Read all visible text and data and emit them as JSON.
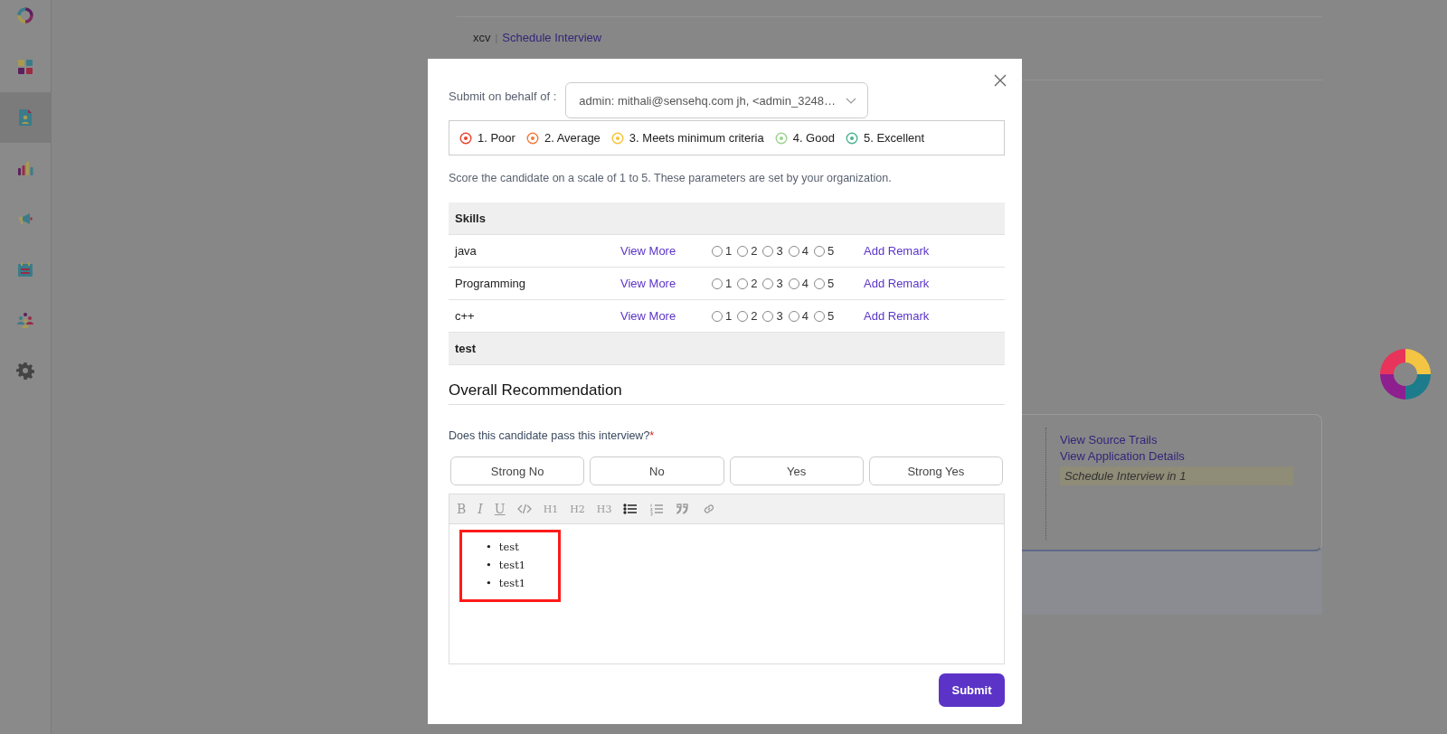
{
  "sidebar": {
    "items": [
      {
        "kind": "logo",
        "selected": false
      },
      {
        "kind": "dashboard",
        "selected": false
      },
      {
        "kind": "candidates",
        "selected": true
      },
      {
        "kind": "reports",
        "selected": false
      },
      {
        "kind": "campaigns",
        "selected": false
      },
      {
        "kind": "calendar",
        "selected": false
      },
      {
        "kind": "team",
        "selected": false
      },
      {
        "kind": "settings",
        "selected": false
      }
    ]
  },
  "page": {
    "breadcrumb": {
      "item": "xcv",
      "separator": "|",
      "link": "Schedule Interview"
    },
    "links": [
      "View Source Trails",
      "View Application Details"
    ],
    "note": "Schedule Interview in 1"
  },
  "modal": {
    "behalf_label": "Submit on behalf of :",
    "behalf_value": "admin: mithali@sensehq.com jh, <admin_3248…",
    "scale": [
      {
        "label": "1. Poor",
        "color": "#e8412c"
      },
      {
        "label": "2. Average",
        "color": "#f47a3a"
      },
      {
        "label": "3. Meets minimum criteria",
        "color": "#f6c431"
      },
      {
        "label": "4. Good",
        "color": "#9bd38f"
      },
      {
        "label": "5. Excellent",
        "color": "#4cb48e"
      }
    ],
    "description": "Score the candidate on a scale of 1 to 5. These parameters are set by your organization.",
    "sections": [
      {
        "title": "Skills",
        "rows": [
          {
            "name": "java",
            "link": "View More",
            "options": [
              {
                "label": "1",
                "selected": false
              },
              {
                "label": "2",
                "selected": false
              },
              {
                "label": "3",
                "selected": false
              },
              {
                "label": "4",
                "selected": false
              },
              {
                "label": "5",
                "selected": false
              }
            ],
            "remark": "Add Remark"
          },
          {
            "name": "Programming",
            "link": "View More",
            "options": [
              {
                "label": "1",
                "selected": false
              },
              {
                "label": "2",
                "selected": false
              },
              {
                "label": "3",
                "selected": false
              },
              {
                "label": "4",
                "selected": false
              },
              {
                "label": "5",
                "selected": false
              }
            ],
            "remark": "Add Remark"
          },
          {
            "name": "c++",
            "link": "View More",
            "options": [
              {
                "label": "1",
                "selected": false
              },
              {
                "label": "2",
                "selected": false
              },
              {
                "label": "3",
                "selected": false
              },
              {
                "label": "4",
                "selected": false
              },
              {
                "label": "5",
                "selected": false
              }
            ],
            "remark": "Add Remark"
          }
        ]
      },
      {
        "title": "test"
      }
    ],
    "recommendation": {
      "heading": "Overall Recommendation",
      "question": "Does this candidate pass this interview?",
      "required_mark": "*",
      "choices": [
        {
          "label": "Strong No",
          "selected": false
        },
        {
          "label": "No",
          "selected": false
        },
        {
          "label": "Yes",
          "selected": false
        },
        {
          "label": "Strong Yes",
          "selected": false
        }
      ]
    },
    "editor": {
      "toolbar": [
        {
          "kind": "bold",
          "label": "B",
          "active": false
        },
        {
          "kind": "italic",
          "label": "I",
          "active": false
        },
        {
          "kind": "underline",
          "label": "U",
          "active": false
        },
        {
          "kind": "code",
          "active": false
        },
        {
          "kind": "heading",
          "label": "H1",
          "active": false
        },
        {
          "kind": "heading",
          "label": "H2",
          "active": false
        },
        {
          "kind": "heading",
          "label": "H3",
          "active": false
        },
        {
          "kind": "bullets",
          "active": true
        },
        {
          "kind": "numbers",
          "active": false
        },
        {
          "kind": "quote",
          "active": false
        },
        {
          "kind": "link",
          "active": false
        }
      ],
      "bullets": [
        {
          "marker": "•",
          "text": "test"
        },
        {
          "marker": "•",
          "text": "test1"
        },
        {
          "marker": "•",
          "text": "test1"
        }
      ],
      "annotation_box": true
    },
    "submit": "Submit"
  }
}
